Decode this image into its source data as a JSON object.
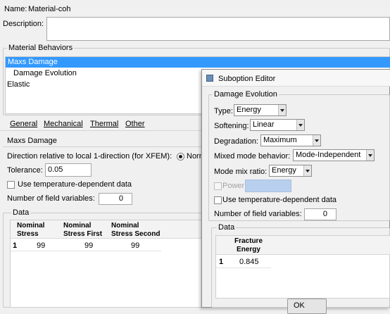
{
  "material": {
    "name_label": "Name:",
    "name_value": "Material-coh",
    "description_label": "Description:",
    "description_value": ""
  },
  "behaviors": {
    "title": "Material Behaviors",
    "items": [
      "Maxs Damage",
      "Damage Evolution",
      "Elastic"
    ]
  },
  "menu": {
    "general": "General",
    "mechanical": "Mechanical",
    "thermal": "Thermal",
    "other": "Other"
  },
  "maxs": {
    "title": "Maxs Damage",
    "direction_label": "Direction relative to local 1-direction (for XFEM):",
    "direction_option": "Norm",
    "tolerance_label": "Tolerance:",
    "tolerance_value": "0.05",
    "temp_dep_label": "Use temperature-dependent data",
    "field_vars_label": "Number of field variables:",
    "field_vars_value": "0",
    "data_title": "Data",
    "columns": [
      "Nominal Stress Normal-only Mode",
      "Nominal Stress First Direction",
      "Nominal Stress Second Direction"
    ],
    "rows": [
      {
        "index": "1",
        "values": [
          "99",
          "99",
          "99"
        ]
      }
    ]
  },
  "suboption": {
    "window_title": "Suboption Editor",
    "section_title": "Damage Evolution",
    "type_label": "Type:",
    "type_value": "Energy",
    "softening_label": "Softening:",
    "softening_value": "Linear",
    "degradation_label": "Degradation:",
    "degradation_value": "Maximum",
    "mixed_mode_label": "Mixed mode behavior:",
    "mixed_mode_value": "Mode-Independent",
    "mode_mix_label": "Mode mix ratio:",
    "mode_mix_value": "Energy",
    "power_label": "Power",
    "temp_dep_label": "Use temperature-dependent data",
    "field_vars_label": "Number of field variables:",
    "field_vars_value": "0",
    "data_title": "Data",
    "column": "Fracture Energy",
    "rows": [
      {
        "index": "1",
        "value": "0.845"
      }
    ],
    "ok_label": "OK"
  },
  "colors": {
    "selection": "#3399ff",
    "background": "#f0f0f0",
    "power_field": "#b8d0ee"
  }
}
